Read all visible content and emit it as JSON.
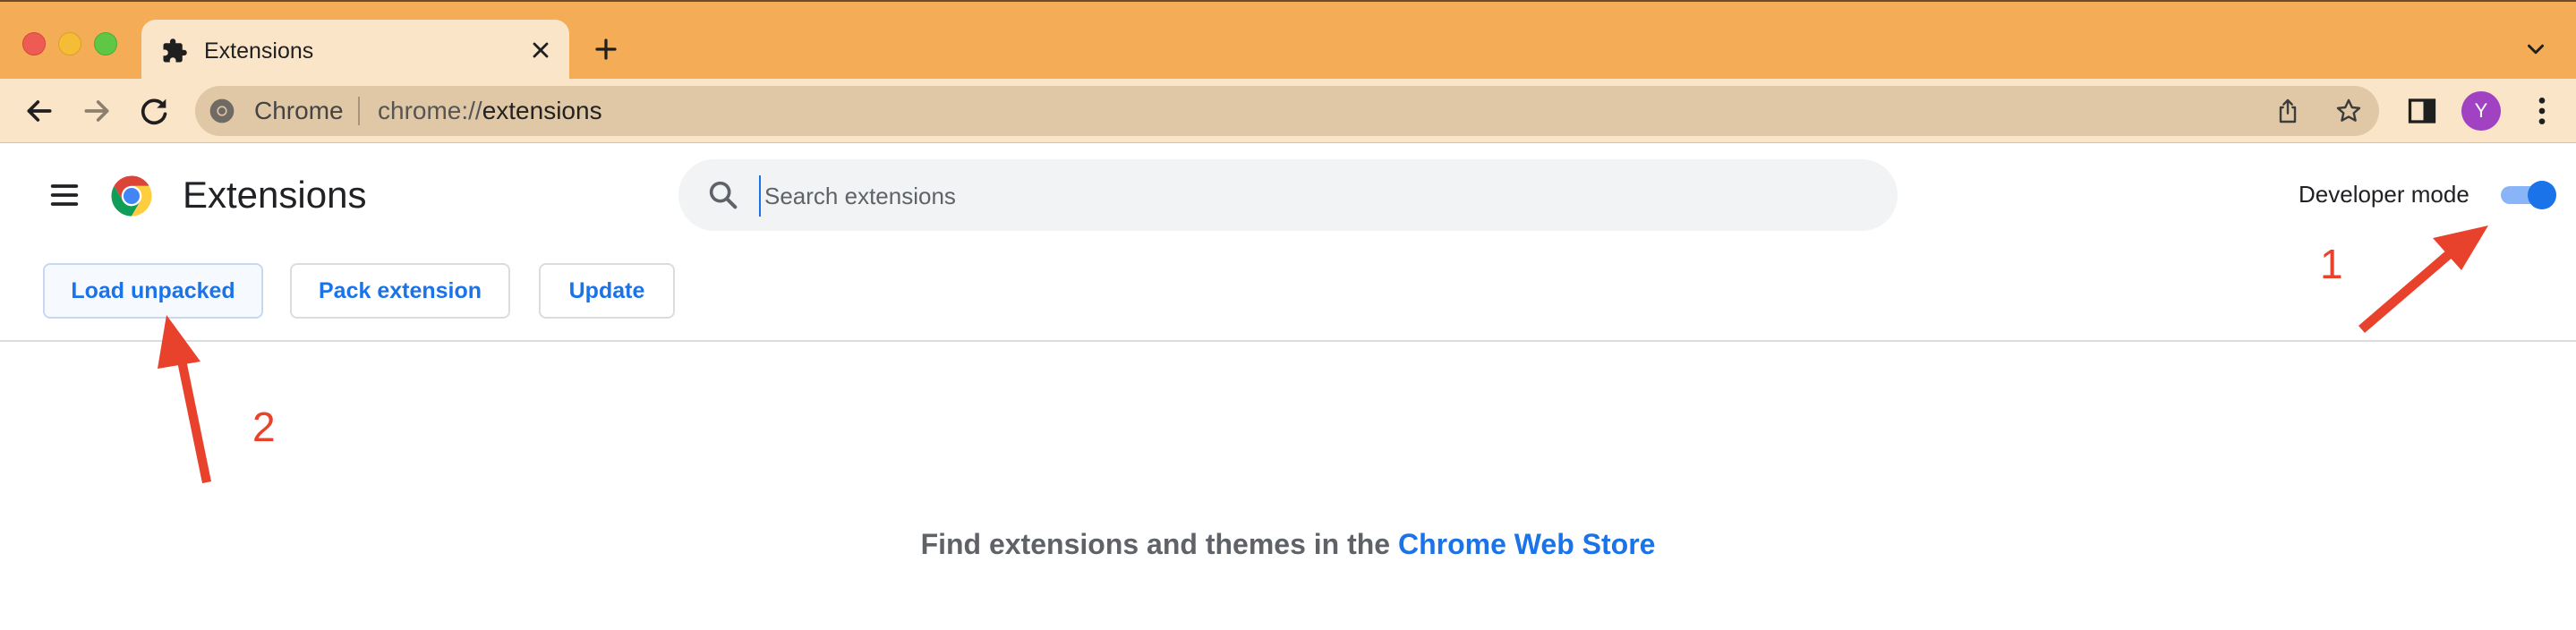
{
  "browser": {
    "tab": {
      "title": "Extensions"
    },
    "omnibox": {
      "chip": "Chrome",
      "url_scheme": "chrome://",
      "url_path": "extensions"
    },
    "profile_initial": "Y",
    "colors": {
      "frame": "#f4ac57",
      "toolbar": "#fae5c9",
      "omnibox": "#e0c7a5",
      "avatar": "#a142c2"
    }
  },
  "page": {
    "title": "Extensions",
    "search": {
      "placeholder": "Search extensions",
      "value": ""
    },
    "developer_mode": {
      "label": "Developer mode",
      "enabled": true
    },
    "buttons": {
      "load_unpacked": "Load unpacked",
      "pack_extension": "Pack extension",
      "update": "Update"
    },
    "empty_state": {
      "prefix": "Find extensions and themes in the ",
      "link": "Chrome Web Store"
    },
    "accent": "#1a73e8"
  },
  "annotations": {
    "step_1": "1",
    "step_2": "2",
    "color": "#e8412c"
  }
}
